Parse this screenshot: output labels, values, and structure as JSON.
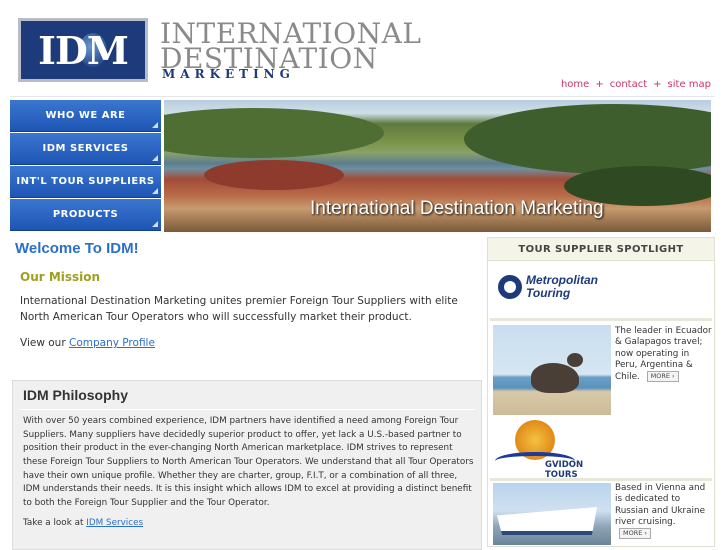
{
  "header": {
    "logo_text": "IDM",
    "brand_line1": "INTERNATIONAL",
    "brand_line2": "DESTINATION",
    "brand_line3": "MARKETING"
  },
  "topnav": {
    "items": [
      "home",
      "contact",
      "site map"
    ],
    "separator": "+"
  },
  "sidebar": {
    "items": [
      {
        "label": "WHO WE ARE"
      },
      {
        "label": "IDM SERVICES"
      },
      {
        "label": "INT'L TOUR SUPPLIERS"
      },
      {
        "label": "PRODUCTS"
      }
    ]
  },
  "hero": {
    "caption": "International Destination Marketing"
  },
  "main": {
    "welcome": "Welcome To IDM!",
    "mission_heading": "Our Mission",
    "mission_text": "International Destination Marketing unites premier Foreign Tour Suppliers with elite North American Tour Operators who will successfully market their product.",
    "view_prefix": "View our",
    "view_link": "Company Profile"
  },
  "philosophy": {
    "title": "IDM Philosophy",
    "body": "With over 50 years combined experience, IDM partners have identified a need among Foreign Tour Suppliers. Many suppliers have decidedly superior product to offer, yet lack a U.S.-based partner to position their product in the ever-changing North American marketplace. IDM strives to represent these Foreign Tour Suppliers to North American Tour Operators. We understand that all Tour Operators have their own unique profile. Whether they are charter, group, F.I.T, or a combination of all three, IDM understands their needs. It is this insight which allows IDM to excel at providing a distinct benefit to both the Foreign Tour Supplier and the Tour Operator.",
    "more_prefix": "Take a look at",
    "more_link": "IDM Services"
  },
  "spotlight": {
    "title": "TOUR SUPPLIER SPOTLIGHT",
    "supplier1": {
      "name_line1": "Metropolitan",
      "name_line2": "Touring",
      "text": "The leader in Ecuador & Galapagos travel; now operating in Peru, Argentina & Chile.",
      "more": "MORE"
    },
    "supplier2": {
      "name": "GVIDON TOURS",
      "text": "Based in Vienna and is dedicated to Russian and Ukraine river cruising.",
      "more": "MORE"
    }
  },
  "colors": {
    "nav_blue": "#1e55b4",
    "link_pink": "#cc3366",
    "welcome_blue": "#2a6fc9",
    "mission_olive": "#a0a020"
  }
}
